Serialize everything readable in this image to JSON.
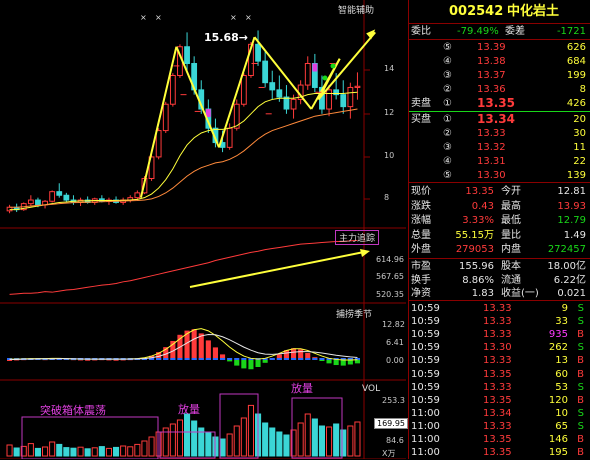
{
  "main_panel": {
    "title": "智能辅助",
    "price_annotation": "15.68→",
    "axis_labels": [
      "14",
      "12",
      "10",
      "8"
    ],
    "chart_data": {
      "type": "candlestick",
      "title": "智能辅助",
      "ylim": [
        7.6,
        16.2
      ],
      "candles": [
        {
          "o": 8.15,
          "h": 8.4,
          "l": 8.05,
          "c": 8.3
        },
        {
          "o": 8.3,
          "h": 8.45,
          "l": 8.1,
          "c": 8.2
        },
        {
          "o": 8.2,
          "h": 8.5,
          "l": 8.15,
          "c": 8.45
        },
        {
          "o": 8.45,
          "h": 8.8,
          "l": 8.35,
          "c": 8.6
        },
        {
          "o": 8.6,
          "h": 8.7,
          "l": 8.3,
          "c": 8.4
        },
        {
          "o": 8.4,
          "h": 8.6,
          "l": 8.25,
          "c": 8.55
        },
        {
          "o": 8.55,
          "h": 9.0,
          "l": 8.5,
          "c": 8.95
        },
        {
          "o": 8.95,
          "h": 9.3,
          "l": 8.7,
          "c": 8.8
        },
        {
          "o": 8.8,
          "h": 8.9,
          "l": 8.5,
          "c": 8.6
        },
        {
          "o": 8.6,
          "h": 8.8,
          "l": 8.4,
          "c": 8.5
        },
        {
          "o": 8.5,
          "h": 8.7,
          "l": 8.35,
          "c": 8.6
        },
        {
          "o": 8.6,
          "h": 8.75,
          "l": 8.45,
          "c": 8.5
        },
        {
          "o": 8.5,
          "h": 8.7,
          "l": 8.4,
          "c": 8.65
        },
        {
          "o": 8.65,
          "h": 8.8,
          "l": 8.5,
          "c": 8.55
        },
        {
          "o": 8.55,
          "h": 8.7,
          "l": 8.4,
          "c": 8.6
        },
        {
          "o": 8.6,
          "h": 8.75,
          "l": 8.45,
          "c": 8.5
        },
        {
          "o": 8.5,
          "h": 8.7,
          "l": 8.4,
          "c": 8.6
        },
        {
          "o": 8.6,
          "h": 8.8,
          "l": 8.5,
          "c": 8.7
        },
        {
          "o": 8.7,
          "h": 9.0,
          "l": 8.6,
          "c": 8.9
        },
        {
          "o": 8.9,
          "h": 9.6,
          "l": 8.85,
          "c": 9.5
        },
        {
          "o": 9.5,
          "h": 10.5,
          "l": 9.4,
          "c": 10.4
        },
        {
          "o": 10.4,
          "h": 11.6,
          "l": 10.3,
          "c": 11.5
        },
        {
          "o": 11.5,
          "h": 12.7,
          "l": 11.4,
          "c": 12.6
        },
        {
          "o": 12.6,
          "h": 13.9,
          "l": 12.5,
          "c": 13.8
        },
        {
          "o": 13.8,
          "h": 15.1,
          "l": 13.7,
          "c": 15.0
        },
        {
          "o": 15.0,
          "h": 15.6,
          "l": 14.0,
          "c": 14.3
        },
        {
          "o": 14.3,
          "h": 14.6,
          "l": 13.0,
          "c": 13.2
        },
        {
          "o": 13.2,
          "h": 13.6,
          "l": 12.2,
          "c": 12.4
        },
        {
          "o": 12.4,
          "h": 12.8,
          "l": 11.4,
          "c": 11.6
        },
        {
          "o": 11.6,
          "h": 12.0,
          "l": 10.8,
          "c": 11.0
        },
        {
          "o": 11.0,
          "h": 11.5,
          "l": 10.6,
          "c": 10.8
        },
        {
          "o": 10.8,
          "h": 11.8,
          "l": 10.7,
          "c": 11.6
        },
        {
          "o": 11.6,
          "h": 12.8,
          "l": 11.5,
          "c": 12.6
        },
        {
          "o": 12.6,
          "h": 13.9,
          "l": 12.5,
          "c": 13.8
        },
        {
          "o": 13.8,
          "h": 15.2,
          "l": 13.7,
          "c": 15.1
        },
        {
          "o": 15.1,
          "h": 15.68,
          "l": 14.2,
          "c": 14.4
        },
        {
          "o": 14.4,
          "h": 14.8,
          "l": 13.3,
          "c": 13.5
        },
        {
          "o": 13.5,
          "h": 14.0,
          "l": 12.8,
          "c": 13.2
        },
        {
          "o": 13.2,
          "h": 13.8,
          "l": 12.7,
          "c": 12.9
        },
        {
          "o": 12.9,
          "h": 13.4,
          "l": 12.2,
          "c": 12.4
        },
        {
          "o": 12.4,
          "h": 13.0,
          "l": 12.0,
          "c": 12.8
        },
        {
          "o": 12.8,
          "h": 13.6,
          "l": 12.6,
          "c": 13.4
        },
        {
          "o": 13.4,
          "h": 14.6,
          "l": 13.2,
          "c": 14.3
        },
        {
          "o": 14.3,
          "h": 14.7,
          "l": 13.1,
          "c": 13.3
        },
        {
          "o": 13.3,
          "h": 13.8,
          "l": 12.2,
          "c": 12.4
        },
        {
          "o": 12.4,
          "h": 13.4,
          "l": 12.1,
          "c": 13.2
        },
        {
          "o": 13.2,
          "h": 13.9,
          "l": 12.8,
          "c": 13.0
        },
        {
          "o": 13.0,
          "h": 13.6,
          "l": 12.2,
          "c": 12.5
        },
        {
          "o": 12.5,
          "h": 13.5,
          "l": 12.0,
          "c": 13.3
        },
        {
          "o": 13.3,
          "h": 13.93,
          "l": 12.79,
          "c": 13.35
        }
      ],
      "ma_yellow": [
        8.2,
        8.2,
        8.25,
        8.3,
        8.35,
        8.4,
        8.45,
        8.5,
        8.52,
        8.55,
        8.56,
        8.57,
        8.58,
        8.58,
        8.58,
        8.58,
        8.59,
        8.6,
        8.63,
        8.7,
        8.85,
        9.1,
        9.45,
        9.9,
        10.45,
        10.9,
        11.2,
        11.4,
        11.5,
        11.55,
        11.55,
        11.6,
        11.7,
        11.9,
        12.2,
        12.5,
        12.7,
        12.8,
        12.85,
        12.85,
        12.85,
        12.9,
        13.0,
        13.05,
        13.05,
        13.05,
        13.05,
        13.05,
        13.08,
        13.1
      ],
      "ma_red": [
        8.3,
        8.3,
        8.32,
        8.35,
        8.38,
        8.4,
        8.42,
        8.45,
        8.47,
        8.49,
        8.5,
        8.51,
        8.52,
        8.53,
        8.54,
        8.55,
        8.56,
        8.57,
        8.58,
        8.6,
        8.65,
        8.75,
        8.9,
        9.1,
        9.35,
        9.6,
        9.8,
        9.95,
        10.05,
        10.15,
        10.2,
        10.3,
        10.45,
        10.65,
        10.9,
        11.15,
        11.35,
        11.5,
        11.6,
        11.7,
        11.8,
        11.9,
        12.0,
        12.1,
        12.15,
        12.2,
        12.25,
        12.3,
        12.35,
        12.4
      ]
    }
  },
  "force_panel": {
    "title": "主力追踪",
    "axis_labels": [
      "614.96",
      "567.65",
      "520.35"
    ],
    "chart_data": {
      "type": "line",
      "title": "主力追踪",
      "ylim": [
        515,
        625
      ],
      "values": [
        518,
        519,
        520,
        520,
        521,
        523,
        522,
        524,
        526,
        527,
        529,
        531,
        533,
        535,
        536,
        538,
        541,
        543,
        546,
        549,
        552,
        555,
        558,
        561,
        564,
        567,
        570,
        573,
        576,
        580,
        583,
        586,
        589,
        592,
        595,
        597,
        600,
        602,
        604,
        606,
        608,
        610,
        611,
        612,
        613,
        614,
        615,
        615,
        616,
        617
      ]
    }
  },
  "macd_panel": {
    "title": "捕捞季节",
    "axis_labels": [
      "12.82",
      "6.41",
      "0.00"
    ],
    "chart_data": {
      "type": "bar",
      "title": "捕捞季节",
      "ylim": [
        -4.5,
        15
      ],
      "values": [
        0,
        0.2,
        0.3,
        0.5,
        0.4,
        0.3,
        0.5,
        0.6,
        0.4,
        0.3,
        0.2,
        0.1,
        0.2,
        0.3,
        0.2,
        0.1,
        0.2,
        0.3,
        0.5,
        0.8,
        1.5,
        2.8,
        4.6,
        6.8,
        9.0,
        10.5,
        11.0,
        9.5,
        7.0,
        4.5,
        2.0,
        -0.5,
        -2.0,
        -3.0,
        -3.3,
        -2.5,
        -1.0,
        0.5,
        2.0,
        3.5,
        4.2,
        3.8,
        2.5,
        1.0,
        -0.3,
        -1.2,
        -1.8,
        -2.0,
        -1.6,
        -1.2
      ],
      "line_yellow": [
        0.3,
        0.3,
        0.4,
        0.5,
        0.5,
        0.5,
        0.6,
        0.6,
        0.5,
        0.4,
        0.3,
        0.3,
        0.3,
        0.3,
        0.3,
        0.3,
        0.3,
        0.4,
        0.5,
        0.8,
        1.4,
        2.4,
        3.8,
        5.6,
        7.6,
        9.4,
        10.8,
        11.2,
        10.4,
        8.8,
        6.8,
        4.6,
        2.8,
        1.4,
        0.6,
        0.3,
        0.6,
        1.4,
        2.4,
        3.4,
        4.0,
        4.0,
        3.4,
        2.4,
        1.4,
        0.6,
        0.2,
        0.0,
        0.0,
        0.1
      ],
      "line_white": [
        0.2,
        0.2,
        0.3,
        0.3,
        0.4,
        0.4,
        0.4,
        0.5,
        0.5,
        0.4,
        0.4,
        0.3,
        0.3,
        0.3,
        0.3,
        0.3,
        0.3,
        0.3,
        0.4,
        0.5,
        0.8,
        1.3,
        2.1,
        3.2,
        4.6,
        6.1,
        7.5,
        8.6,
        9.1,
        9.0,
        8.3,
        7.2,
        5.9,
        4.6,
        3.5,
        2.6,
        2.1,
        2.0,
        2.2,
        2.5,
        2.8,
        3.0,
        3.0,
        2.8,
        2.5,
        2.1,
        1.7,
        1.4,
        1.1,
        0.9
      ]
    }
  },
  "volume_panel": {
    "title": "VOL",
    "axis_labels": [
      "253.3",
      "169.95",
      "84.6",
      "X万"
    ],
    "current_value": "169.95",
    "annotations": [
      "突破箱体震荡",
      "放量",
      "放量"
    ],
    "chart_data": {
      "type": "bar",
      "title": "VOL",
      "ylabel": "X万",
      "ylim": [
        0,
        300
      ],
      "values": [
        55,
        40,
        48,
        62,
        38,
        45,
        70,
        58,
        42,
        39,
        44,
        36,
        41,
        47,
        38,
        43,
        50,
        46,
        58,
        75,
        95,
        120,
        140,
        160,
        180,
        210,
        175,
        140,
        120,
        95,
        85,
        110,
        150,
        190,
        253,
        210,
        165,
        140,
        120,
        105,
        130,
        165,
        210,
        185,
        150,
        145,
        160,
        130,
        150,
        170
      ]
    }
  },
  "quote": {
    "code": "002542",
    "name": "中化岩土",
    "commission_ratio_label": "委比",
    "commission_ratio": "-79.49%",
    "commission_diff_label": "委差",
    "commission_diff": "-1721",
    "sell_label": "卖盘",
    "buy_label": "买盘",
    "asks": [
      {
        "n": "⑤",
        "price": "13.39",
        "vol": "626"
      },
      {
        "n": "④",
        "price": "13.38",
        "vol": "684"
      },
      {
        "n": "③",
        "price": "13.37",
        "vol": "199"
      },
      {
        "n": "②",
        "price": "13.36",
        "vol": "8"
      },
      {
        "n": "①",
        "price": "13.35",
        "vol": "426"
      }
    ],
    "bids": [
      {
        "n": "①",
        "price": "13.34",
        "vol": "20"
      },
      {
        "n": "②",
        "price": "13.33",
        "vol": "30"
      },
      {
        "n": "③",
        "price": "13.32",
        "vol": "11"
      },
      {
        "n": "④",
        "price": "13.31",
        "vol": "22"
      },
      {
        "n": "⑤",
        "price": "13.30",
        "vol": "139"
      }
    ],
    "stats": [
      {
        "l1": "现价",
        "v1": "13.35",
        "c1": "red",
        "l2": "今开",
        "v2": "12.81",
        "c2": "wht"
      },
      {
        "l1": "涨跌",
        "v1": "0.43",
        "c1": "red",
        "l2": "最高",
        "v2": "13.93",
        "c2": "red"
      },
      {
        "l1": "涨幅",
        "v1": "3.33%",
        "c1": "red",
        "l2": "最低",
        "v2": "12.79",
        "c2": "grn"
      },
      {
        "l1": "总量",
        "v1": "55.15万",
        "c1": "yel",
        "l2": "量比",
        "v2": "1.49",
        "c2": "wht"
      },
      {
        "l1": "外盘",
        "v1": "279053",
        "c1": "red",
        "l2": "内盘",
        "v2": "272457",
        "c2": "grn"
      }
    ],
    "stats2": [
      {
        "l1": "市盈",
        "v1": "155.96",
        "l2": "股本",
        "v2": "18.00亿"
      },
      {
        "l1": "换手",
        "v1": "8.86%",
        "l2": "流通",
        "v2": "6.22亿"
      },
      {
        "l1": "净资",
        "v1": "1.83",
        "l2": "收益(一)",
        "v2": "0.021"
      }
    ],
    "ticks": [
      {
        "t": "10:59",
        "p": "13.33",
        "v": "9",
        "s": "S",
        "vc": "yel"
      },
      {
        "t": "10:59",
        "p": "13.33",
        "v": "33",
        "s": "S",
        "vc": "yel"
      },
      {
        "t": "10:59",
        "p": "13.33",
        "v": "935",
        "s": "B",
        "vc": "mag"
      },
      {
        "t": "10:59",
        "p": "13.30",
        "v": "262",
        "s": "S",
        "vc": "yel"
      },
      {
        "t": "10:59",
        "p": "13.33",
        "v": "13",
        "s": "B",
        "vc": "yel"
      },
      {
        "t": "10:59",
        "p": "13.35",
        "v": "60",
        "s": "B",
        "vc": "yel"
      },
      {
        "t": "10:59",
        "p": "13.33",
        "v": "53",
        "s": "S",
        "vc": "yel"
      },
      {
        "t": "10:59",
        "p": "13.35",
        "v": "120",
        "s": "B",
        "vc": "yel"
      },
      {
        "t": "11:00",
        "p": "13.34",
        "v": "10",
        "s": "S",
        "vc": "yel"
      },
      {
        "t": "11:00",
        "p": "13.33",
        "v": "65",
        "s": "S",
        "vc": "yel"
      },
      {
        "t": "11:00",
        "p": "13.35",
        "v": "146",
        "s": "B",
        "vc": "yel"
      },
      {
        "t": "11:00",
        "p": "13.35",
        "v": "195",
        "s": "B",
        "vc": "yel"
      }
    ]
  }
}
